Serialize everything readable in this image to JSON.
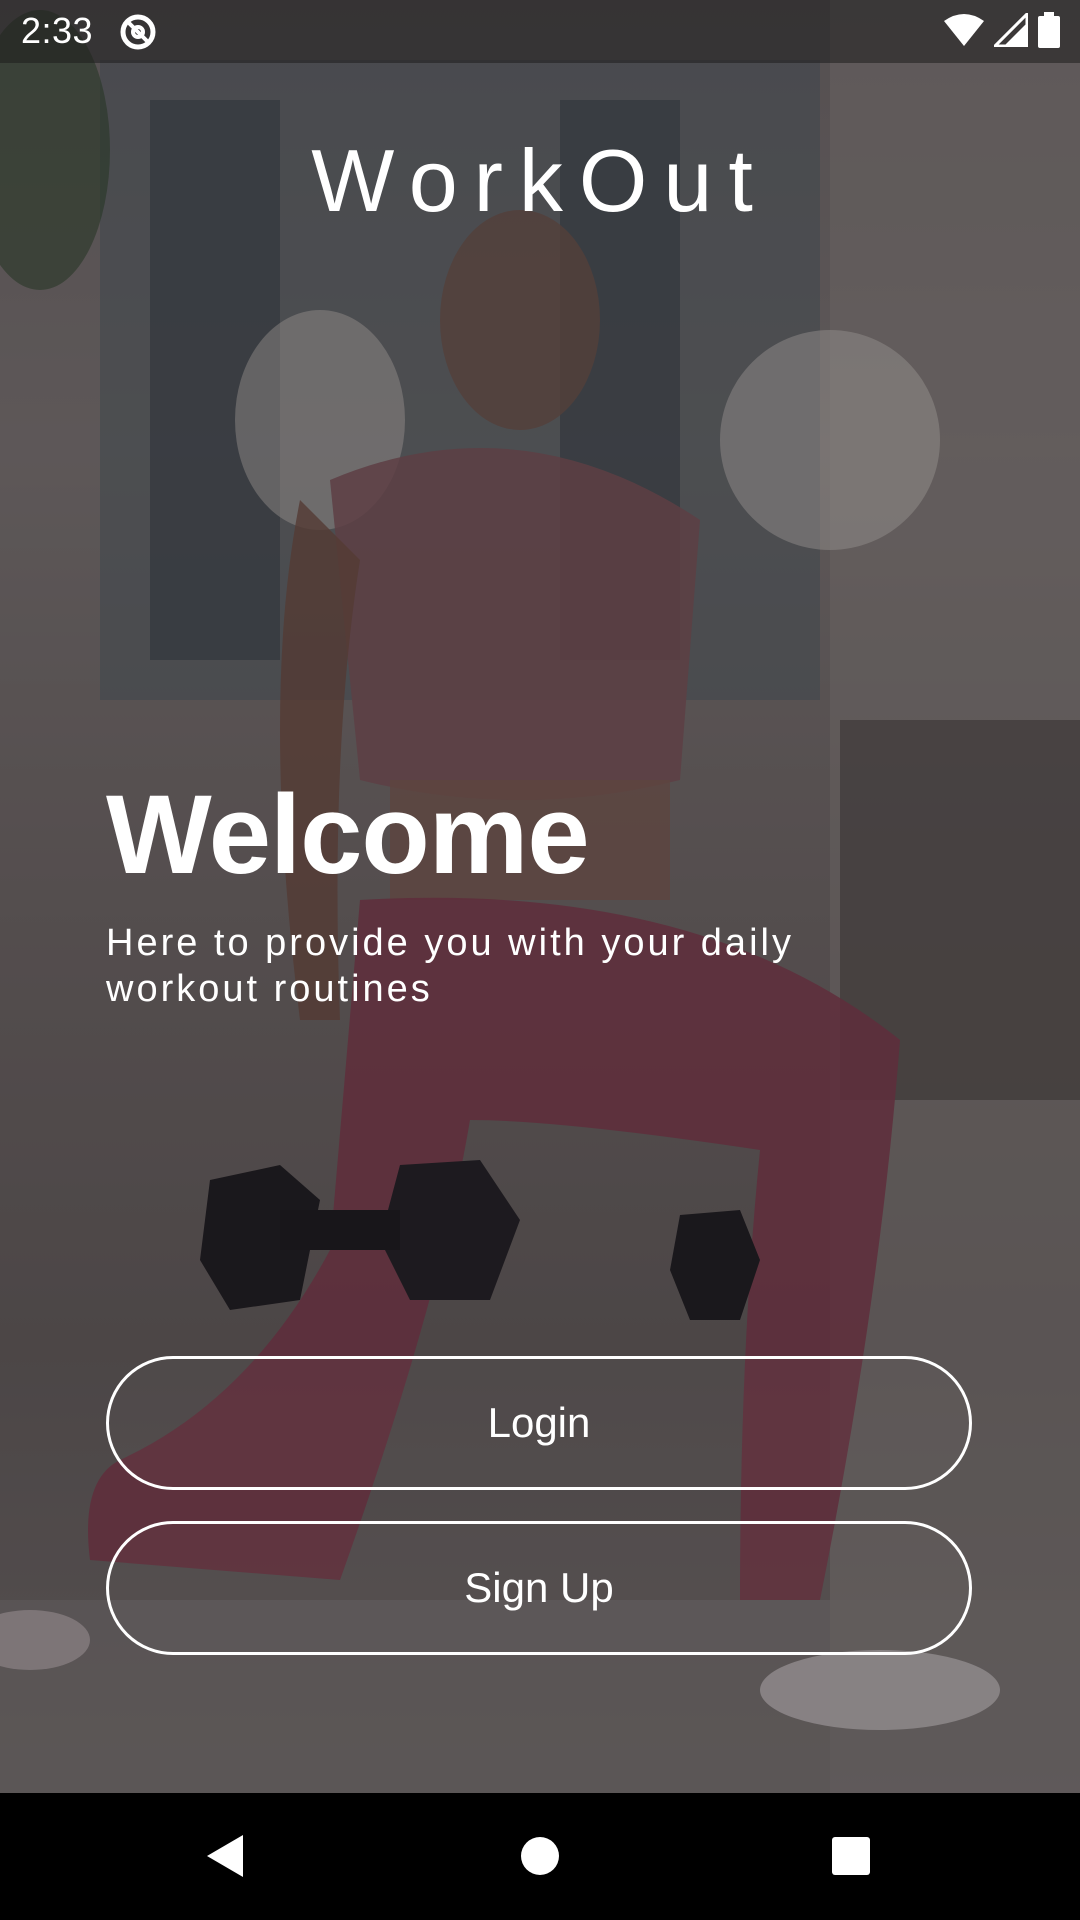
{
  "status_bar": {
    "time": "2:33",
    "app_icon": "at-sign-icon",
    "icons": [
      "wifi-icon",
      "cellular-signal-icon",
      "battery-icon"
    ]
  },
  "app": {
    "title": "WorkOut"
  },
  "hero": {
    "heading": "Welcome",
    "subtitle": "Here to provide you with your daily workout routines"
  },
  "actions": {
    "login_label": "Login",
    "signup_label": "Sign Up"
  },
  "nav_bar": {
    "icons": [
      "back-icon",
      "home-icon",
      "recents-icon"
    ]
  },
  "colors": {
    "text": "#ffffff",
    "nav_background": "#000000"
  }
}
